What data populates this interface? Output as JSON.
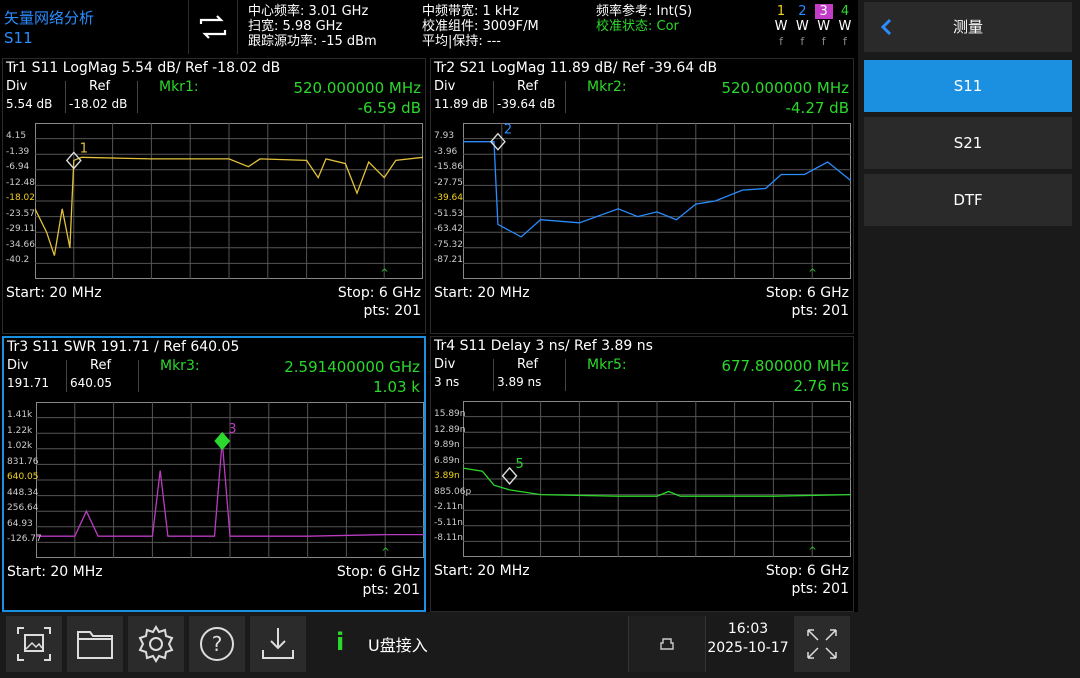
{
  "header": {
    "app_title": "矢量网络分析",
    "measure": "S11",
    "col1": [
      "中心频率: 3.01 GHz",
      "扫宽: 5.98 GHz",
      "跟踪源功率: -15 dBm"
    ],
    "col2": [
      "中频带宽: 1 kHz",
      "校准组件: 3009F/M",
      "平均|保持: ---"
    ],
    "col3_line1": "频率参考: Int(S)",
    "col3_line2": "校准状态: Cor",
    "traces": [
      {
        "num": "1",
        "mode": "W",
        "state": "f",
        "color": "#f2d21b"
      },
      {
        "num": "2",
        "mode": "W",
        "state": "f",
        "color": "#2a8cff"
      },
      {
        "num": "3",
        "mode": "W",
        "state": "f",
        "color": "#c23cc8"
      },
      {
        "num": "4",
        "mode": "W",
        "state": "f",
        "color": "#2bd82b"
      }
    ]
  },
  "right_panel": {
    "title": "测量",
    "items": [
      "S11",
      "S21",
      "DTF"
    ],
    "active": "S11"
  },
  "panels": [
    {
      "title": "Tr1 S11 LogMag 5.54 dB/ Ref -18.02 dB",
      "div_label": "Div",
      "div_value": "5.54 dB",
      "ref_label": "Ref",
      "ref_value": "-18.02 dB",
      "mkr_label": "Mkr1:",
      "mkr_freq": "520.000000 MHz",
      "mkr_val": "-6.59 dB",
      "color": "#e3c23a",
      "ylabels": [
        "4.15",
        "-1.39",
        "-6.94",
        "-12.48",
        "-18.02",
        "-23.57",
        "-29.11",
        "-34.66",
        "-40.2"
      ],
      "ref_index": 4,
      "marker_num": "1",
      "start": "Start: 20 MHz",
      "stop": "Stop: 6 GHz",
      "pts": "pts: 201"
    },
    {
      "title": "Tr2 S21 LogMag 11.89 dB/ Ref -39.64 dB",
      "div_label": "Div",
      "div_value": "11.89 dB",
      "ref_label": "Ref",
      "ref_value": "-39.64 dB",
      "mkr_label": "Mkr2:",
      "mkr_freq": "520.000000 MHz",
      "mkr_val": "-4.27 dB",
      "color": "#2a8cff",
      "ylabels": [
        "7.93",
        "-3.96",
        "-15.86",
        "-27.75",
        "-39.64",
        "-51.53",
        "-63.42",
        "-75.32",
        "-87.21"
      ],
      "ref_index": 4,
      "marker_num": "2",
      "start": "Start: 20 MHz",
      "stop": "Stop: 6 GHz",
      "pts": "pts: 201"
    },
    {
      "title": "Tr3 S11 SWR 191.71 / Ref 640.05",
      "div_label": "Div",
      "div_value": "191.71",
      "ref_label": "Ref",
      "ref_value": "640.05",
      "mkr_label": "Mkr3:",
      "mkr_freq": "2.591400000 GHz",
      "mkr_val": "1.03 k",
      "color": "#b93cc0",
      "ylabels": [
        "1.41k",
        "1.22k",
        "1.02k",
        "831.76",
        "640.05",
        "448.34",
        "256.64",
        "64.93",
        "-126.77"
      ],
      "ref_index": 4,
      "marker_num": "3",
      "start": "Start: 20 MHz",
      "stop": "Stop: 6 GHz",
      "pts": "pts: 201"
    },
    {
      "title": "Tr4 S11 Delay 3 ns/ Ref 3.89 ns",
      "div_label": "Div",
      "div_value": "3 ns",
      "ref_label": "Ref",
      "ref_value": "3.89 ns",
      "mkr_label": "Mkr5:",
      "mkr_freq": "677.800000 MHz",
      "mkr_val": "2.76 ns",
      "color": "#2bd82b",
      "ylabels": [
        "15.89n",
        "12.89n",
        "9.89n",
        "6.89n",
        "3.89n",
        "885.06p",
        "-2.11n",
        "-5.11n",
        "-8.11n"
      ],
      "ref_index": 4,
      "marker_num": "5",
      "start": "Start: 20 MHz",
      "stop": "Stop: 6 GHz",
      "pts": "pts: 201"
    }
  ],
  "footer": {
    "status_text": "U盘接入",
    "time": "16:03",
    "date": "2025-10-17"
  }
}
